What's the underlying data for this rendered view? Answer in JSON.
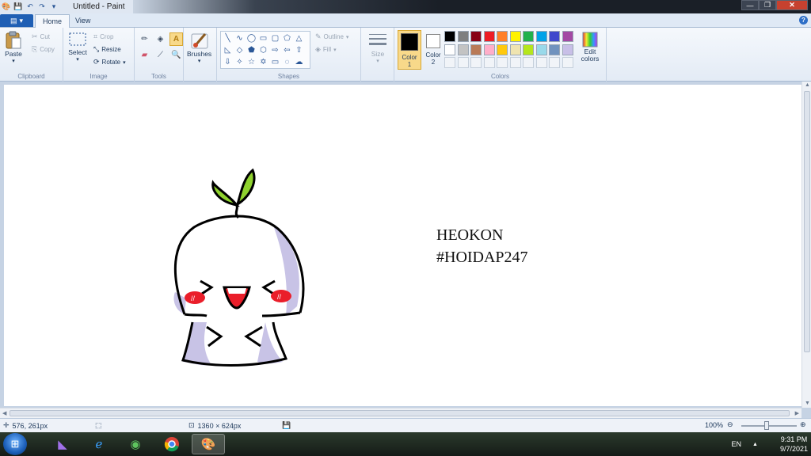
{
  "window": {
    "title": "Untitled - Paint",
    "qat_icons": [
      "save-icon",
      "undo-icon",
      "redo-icon",
      "customize-qat-icon"
    ]
  },
  "tabs": {
    "home": "Home",
    "view": "View"
  },
  "ribbon": {
    "clipboard": {
      "label": "Clipboard",
      "paste": "Paste",
      "cut": "Cut",
      "copy": "Copy"
    },
    "image": {
      "label": "Image",
      "select": "Select",
      "crop": "Crop",
      "resize": "Resize",
      "rotate": "Rotate"
    },
    "tools": {
      "label": "Tools"
    },
    "brushes": {
      "label": "Brushes"
    },
    "shapes": {
      "label": "Shapes",
      "outline": "Outline",
      "fill": "Fill"
    },
    "size": {
      "label": "Size"
    },
    "colors": {
      "label": "Colors",
      "color1": "Color 1",
      "color2": "Color 2",
      "edit": "Edit colors",
      "color1_value": "#000000",
      "color2_value": "#ffffff",
      "palette_row1": [
        "#000000",
        "#7f7f7f",
        "#880015",
        "#ed1c24",
        "#ff7f27",
        "#fff200",
        "#22b14c",
        "#00a2e8",
        "#3f48cc",
        "#a349a4"
      ],
      "palette_row2": [
        "#ffffff",
        "#c3c3c3",
        "#b97a57",
        "#ffaec9",
        "#ffc90e",
        "#efe4b0",
        "#b5e61d",
        "#99d9ea",
        "#7092be",
        "#c8bfe7"
      ]
    }
  },
  "canvas": {
    "text_line1": "HEOKON",
    "text_line2": "#HOIDAP247",
    "cheek_marks": "//"
  },
  "status": {
    "cursor_pos": "576, 261px",
    "canvas_size": "1360 × 624px",
    "zoom": "100%"
  },
  "taskbar": {
    "apps": [
      "visual-studio-icon",
      "internet-explorer-icon",
      "coccoc-browser-icon",
      "chrome-icon",
      "paint-icon"
    ],
    "language": "EN",
    "time": "9:31 PM",
    "date": "9/7/2021"
  }
}
